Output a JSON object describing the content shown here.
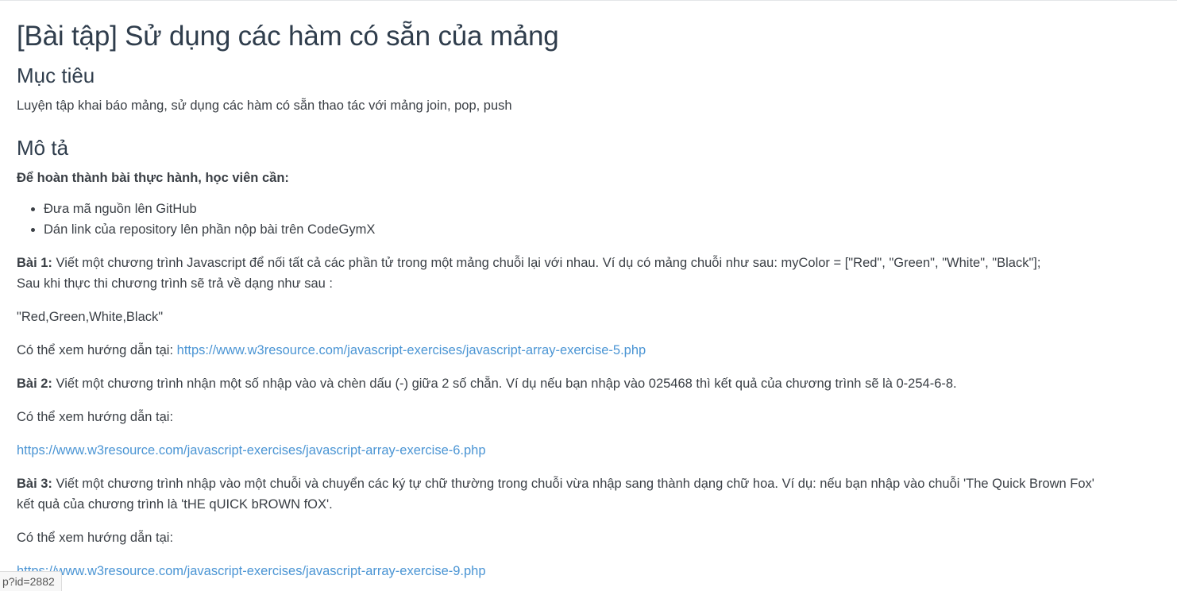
{
  "title": "[Bài tập] Sử dụng các hàm có sẵn của mảng",
  "goal": {
    "heading": "Mục tiêu",
    "text": "Luyện tập khai báo mảng, sử dụng các hàm có sẵn thao tác với mảng join, pop, push"
  },
  "description": {
    "heading": "Mô tả",
    "lead": "Để hoàn thành bài thực hành, học viên cần:",
    "requirements": [
      "Đưa mã nguồn lên GitHub",
      "Dán link của repository lên phần nộp bài trên CodeGymX"
    ]
  },
  "exercise1": {
    "label": "Bài 1:",
    "text": " Viết một chương trình Javascript để nối tất cả các phần tử trong một mảng chuỗi lại với nhau. Ví dụ có mảng chuỗi như sau: myColor = [\"Red\", \"Green\", \"White\", \"Black\"];",
    "text2": "Sau khi thực thi chương trình sẽ trả về dạng như sau :",
    "output": "\"Red,Green,White,Black\"",
    "guide_prefix": "Có thể xem hướng dẫn tại: ",
    "guide_link": "https://www.w3resource.com/javascript-exercises/javascript-array-exercise-5.php"
  },
  "exercise2": {
    "label": "Bài 2:",
    "text": " Viết một chương trình nhận một số nhập vào và chèn dấu (-) giữa 2  số chẵn. Ví dụ nếu bạn nhập vào 025468 thì kết quả của chương trình sẽ là 0-254-6-8.",
    "guide_prefix": "Có thể xem hướng dẫn tại:",
    "guide_link": "https://www.w3resource.com/javascript-exercises/javascript-array-exercise-6.php"
  },
  "exercise3": {
    "label": "Bài 3:",
    "text": " Viết một chương trình nhập vào một chuỗi và chuyển các ký tự chữ thường trong chuỗi vừa nhập sang thành dạng chữ hoa. Ví dụ: nếu bạn nhập vào chuỗi 'The Quick Brown Fox'",
    "text2": "kết quả của chương trình là 'tHE qUICK bROWN fOX'.",
    "guide_prefix": "Có thể xem hướng dẫn tại:",
    "guide_link": "https://www.w3resource.com/javascript-exercises/javascript-array-exercise-9.php"
  },
  "status_bar": {
    "url_fragment": "p?id=2882"
  },
  "colors": {
    "link": "#4b95d4",
    "heading": "#2f3d4c",
    "text": "#3a3f45"
  }
}
